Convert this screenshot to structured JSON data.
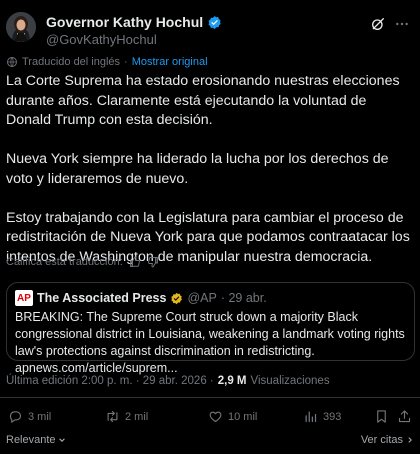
{
  "author": {
    "display_name": "Governor Kathy Hochul",
    "handle": "@GovKathyHochul"
  },
  "translation": {
    "label": "Traducido del inglés",
    "show_original": "Mostrar original"
  },
  "tweet": {
    "paragraphs": [
      "La Corte Suprema ha estado erosionando nuestras elecciones durante años. Claramente está ejecutando la voluntad de Donald Trump con esta decisión.",
      "Nueva York siempre ha liderado la lucha por los derechos de voto y lideraremos de nuevo.",
      "Estoy trabajando con la Legislatura para cambiar el proceso de redistritación de Nueva York para que podamos contraatacar los intentos de Washington de manipular nuestra democracia."
    ],
    "rate_translation": "Califica esta traducción:"
  },
  "quote": {
    "logo_text": "AP",
    "name": "The Associated Press",
    "handle": "@AP",
    "date": "· 29 abr.",
    "text": "BREAKING: The Supreme Court struck down a majority Black congressional district in Louisiana, weakening a landmark voting rights law's protections against discrimination in redistricting. apnews.com/article/suprem..."
  },
  "meta": {
    "edited": "Última edición 2:00 p. m. · 29 abr. 2026 ·",
    "views_count": "2,9 M",
    "views_label": "Visualizaciones"
  },
  "actions": {
    "replies": "3 mil",
    "reposts": "2 mil",
    "likes": "10 mil",
    "views": "393"
  },
  "footer": {
    "relevant": "Relevante",
    "see_quotes": "Ver citas"
  },
  "colors": {
    "background": "#000000",
    "text": "#e7e9ea",
    "muted": "#71767b",
    "accent": "#1d9bf0",
    "border": "#2f3336"
  }
}
